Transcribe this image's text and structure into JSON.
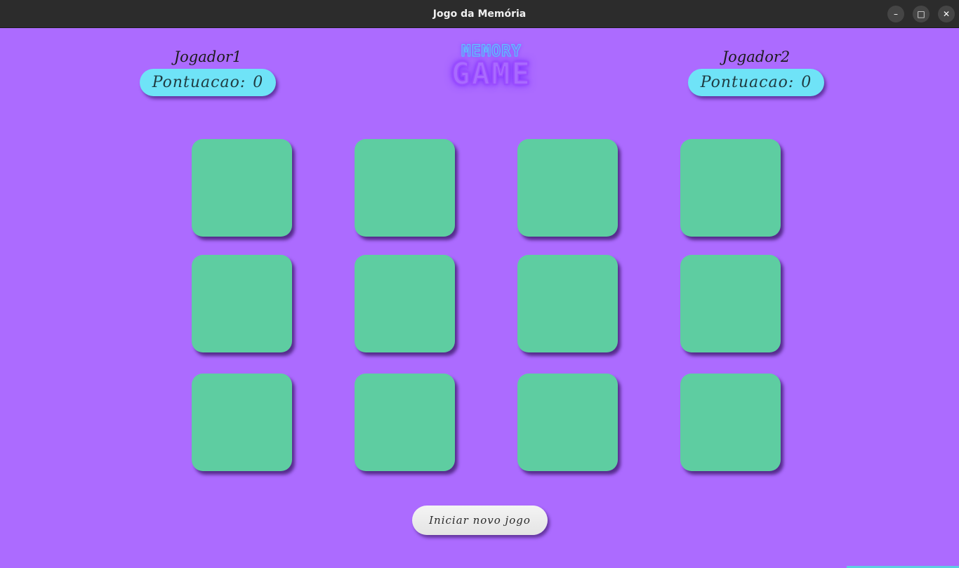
{
  "window": {
    "title": "Jogo da Memória",
    "controls": {
      "minimize": "–",
      "maximize": "□",
      "close": "✕"
    }
  },
  "players": [
    {
      "name": "Jogador1",
      "score_label": "Pontuacao:",
      "score": "0"
    },
    {
      "name": "Jogador2",
      "score_label": "Pontuacao:",
      "score": "0"
    }
  ],
  "logo": {
    "top": "MEMORY",
    "bottom": "GAME"
  },
  "board": {
    "rows": 3,
    "cols": 4,
    "cards_face_down": 12
  },
  "actions": {
    "new_game_label": "Iniciar novo jogo"
  },
  "colors": {
    "background": "#ac6bff",
    "card_back": "#5ecda1",
    "score_pill": "#6fe3f7",
    "button": "#eeeeee",
    "titlebar": "#2c2c2c"
  }
}
